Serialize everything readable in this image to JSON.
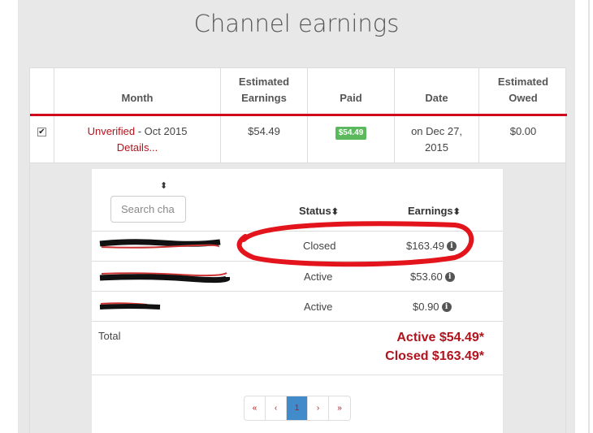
{
  "title": "Channel earnings",
  "table": {
    "headers": [
      "Month",
      "Estimated\nEarnings",
      "Paid",
      "Date",
      "Estimated\nOwed"
    ],
    "row": {
      "status": "Unverified",
      "month": " - Oct 2015",
      "details_link": "Details...",
      "estimated_earnings": "$54.49",
      "paid_badge": "$54.49",
      "date": "on Dec 27,\n2015",
      "estimated_owed": "$0.00",
      "checked": "✔"
    }
  },
  "detail": {
    "sort_icon": "⬍",
    "search_placeholder": "Search cha",
    "headers": {
      "status": "Status",
      "earnings": "Earnings"
    },
    "sort_glyph": "⬍",
    "rows": [
      {
        "status": "Closed",
        "earnings": "$163.49"
      },
      {
        "status": "Active",
        "earnings": "$53.60"
      },
      {
        "status": "Active",
        "earnings": "$0.90"
      }
    ],
    "info_glyph": "i",
    "total_label": "Total",
    "total_active": "Active $54.49*",
    "total_closed": "Closed $163.49*"
  },
  "pagination": [
    "«",
    "‹",
    "1",
    "›",
    "»"
  ],
  "colors": {
    "accent_red": "#d0021b",
    "link_red": "#b1141c",
    "paid_green": "#5cb85c",
    "active_page": "#428bca"
  }
}
